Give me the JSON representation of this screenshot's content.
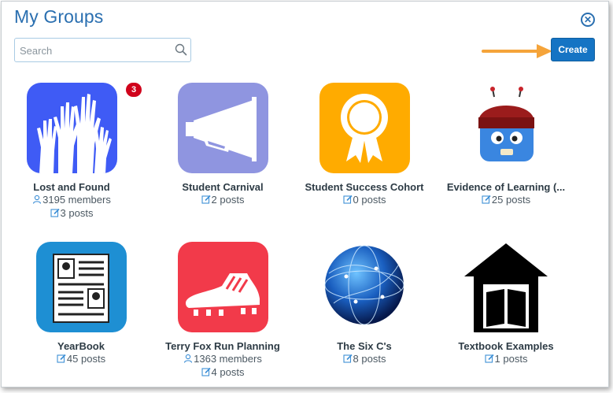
{
  "header": {
    "title": "My Groups",
    "close_icon": "close-circle-icon"
  },
  "search": {
    "placeholder": "Search",
    "value": "",
    "icon": "search-icon"
  },
  "toolbar": {
    "create_label": "Create"
  },
  "colors": {
    "accent": "#1574c4",
    "title": "#2a6fb0",
    "badge": "#d0021b",
    "arrow": "#f5a43a"
  },
  "groups": [
    {
      "name": "Lost and Found",
      "members": "3195 members",
      "posts": "3 posts",
      "badge": "3",
      "image": "raised-hands-icon",
      "color": "#3f5bf5"
    },
    {
      "name": "Student Carnival",
      "posts": "2 posts",
      "image": "megaphone-icon",
      "color": "#8f95e0"
    },
    {
      "name": "Student Success Cohort",
      "posts": "0 posts",
      "image": "award-ribbon-icon",
      "color": "#ffab00"
    },
    {
      "name": "Evidence of Learning (...",
      "posts": "25 posts",
      "image": "toque-monster-icon",
      "color": "#ffffff"
    },
    {
      "name": "YearBook",
      "posts": "45 posts",
      "image": "yearbook-page-icon",
      "color": "#1e8fd3"
    },
    {
      "name": "Terry Fox Run Planning",
      "members": "1363 members",
      "posts": "4 posts",
      "image": "running-shoe-icon",
      "color": "#f23a4a"
    },
    {
      "name": "The Six C's",
      "posts": "8 posts",
      "image": "globe-network-icon",
      "color": "#ffffff"
    },
    {
      "name": "Textbook Examples",
      "posts": "1 posts",
      "image": "book-house-icon",
      "color": "#ffffff"
    }
  ]
}
